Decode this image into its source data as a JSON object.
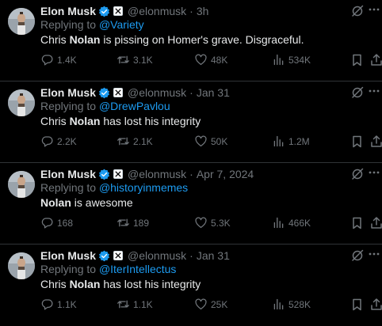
{
  "colors": {
    "background": "#000000",
    "text": "#e7e9ea",
    "muted": "#71767b",
    "link": "#1d9bf0",
    "divider": "#2f3336"
  },
  "icons": [
    "avatar",
    "verified-badge-icon",
    "x-affiliate-badge-icon",
    "grok-icon",
    "more-icon",
    "reply-icon",
    "retweet-icon",
    "like-icon",
    "views-icon",
    "bookmark-icon",
    "share-icon"
  ],
  "tweets": [
    {
      "name": "Elon Musk",
      "handle": "@elonmusk",
      "dot": "·",
      "time": "3h",
      "replying_prefix": "Replying to",
      "replying_to": "@Variety",
      "text_before": "Chris ",
      "text_bold": "Nolan",
      "text_after": " is pissing on Homer's grave. Disgraceful.",
      "replies": "1.4K",
      "retweets": "3.1K",
      "likes": "48K",
      "views": "534K"
    },
    {
      "name": "Elon Musk",
      "handle": "@elonmusk",
      "dot": "·",
      "time": "Jan 31",
      "replying_prefix": "Replying to",
      "replying_to": "@DrewPavlou",
      "text_before": "Chris ",
      "text_bold": "Nolan",
      "text_after": " has lost his integrity",
      "replies": "2.2K",
      "retweets": "2.1K",
      "likes": "50K",
      "views": "1.2M"
    },
    {
      "name": "Elon Musk",
      "handle": "@elonmusk",
      "dot": "·",
      "time": "Apr 7, 2024",
      "replying_prefix": "Replying to",
      "replying_to": "@historyinmemes",
      "text_before": "",
      "text_bold": "Nolan",
      "text_after": " is awesome",
      "replies": "168",
      "retweets": "189",
      "likes": "5.3K",
      "views": "466K"
    },
    {
      "name": "Elon Musk",
      "handle": "@elonmusk",
      "dot": "·",
      "time": "Jan 31",
      "replying_prefix": "Replying to",
      "replying_to": "@IterIntellectus",
      "text_before": "Chris ",
      "text_bold": "Nolan",
      "text_after": " has lost his integrity",
      "replies": "1.1K",
      "retweets": "1.1K",
      "likes": "25K",
      "views": "528K"
    }
  ]
}
